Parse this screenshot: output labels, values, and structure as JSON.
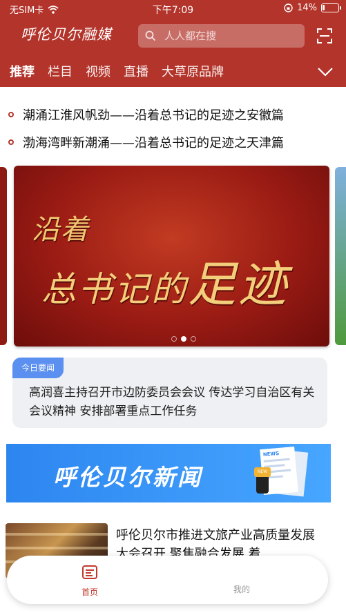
{
  "status_bar": {
    "carrier": "无SIM卡",
    "time": "下午7:09",
    "battery_percent": "14%",
    "battery_level": 0.14
  },
  "header": {
    "logo_text": "呼伦贝尔融媒",
    "search_placeholder": "人人都在搜",
    "tabs": [
      {
        "label": "推荐",
        "active": true
      },
      {
        "label": "栏目",
        "active": false
      },
      {
        "label": "视频",
        "active": false
      },
      {
        "label": "直播",
        "active": false
      },
      {
        "label": "大草原品牌",
        "active": false
      }
    ]
  },
  "headlines": [
    "潮涌江淮风帆劲——沿着总书记的足迹之安徽篇",
    "渤海湾畔新潮涌——沿着总书记的足迹之天津篇"
  ],
  "carousel": {
    "slide_line1": "沿着",
    "slide_line2_a": "总书记的",
    "slide_line2_b": "足迹",
    "page_count": 3,
    "active_page": 2
  },
  "today": {
    "badge": "今日要闻",
    "text": "高润喜主持召开市边防委员会会议 传达学习自治区有关会议精神 安排部署重点工作任务"
  },
  "banner": {
    "text": "呼伦贝尔新闻",
    "paper_label": "NEWS",
    "mic_label": "NEW"
  },
  "news_item": {
    "title": "呼伦贝尔市推进文旅产业高质量发展大会召开 聚焦融合发展 着"
  },
  "tabbar": {
    "home_label": "首页",
    "me_label": "我的"
  },
  "colors": {
    "brand_red": "#b3342b",
    "badge_blue": "#5b8ff0",
    "banner_blue": "#2d86f0"
  }
}
